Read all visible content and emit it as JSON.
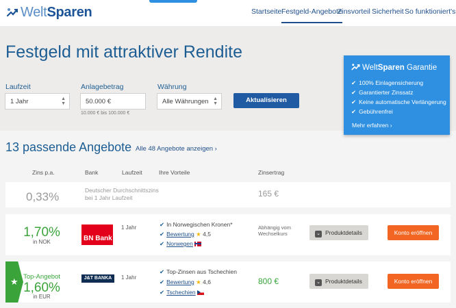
{
  "brand": {
    "part1": "Welt",
    "part2": "Sparen"
  },
  "nav": [
    "Startseite",
    "Festgeld-Angebote",
    "Zinsvorteil",
    "Sicherheit",
    "So funktioniert's"
  ],
  "hero": {
    "title": "Festgeld mit attraktiver Rendite",
    "laufzeit_label": "Laufzeit",
    "laufzeit_value": "1 Jahr",
    "betrag_label": "Anlagebetrag",
    "betrag_value": "50.000 €",
    "betrag_hint": "10.000 € bis 100.000 €",
    "waehrung_label": "Währung",
    "waehrung_value": "Alle Währungen",
    "update_button": "Aktualisieren"
  },
  "guarantee": {
    "brand1": "Welt",
    "brand2": "Sparen",
    "title": "Garantie",
    "items": [
      "100% Einlagensicherung",
      "Garantierter Zinssatz",
      "Keine automatische Verlängerung",
      "Gebührenfrei"
    ],
    "more_link": "Mehr erfahren ›"
  },
  "results": {
    "title": "13 passende Angebote",
    "all_link": "Alle 48 Angebote anzeigen ›",
    "columns": [
      "Zins p.a.",
      "Bank",
      "Laufzeit",
      "Ihre Vorteile",
      "Zinsertrag"
    ]
  },
  "average": {
    "rate": "0,33%",
    "text_line1": "Deutscher Durchschnittszins",
    "text_line2": "bei 1 Jahr Laufzeit",
    "interest": "165 €"
  },
  "offers": [
    {
      "top_label": "",
      "rate": "1,70%",
      "currency_text": "in NOK",
      "bank": "BN Bank",
      "term": "1 Jahr",
      "feature1": "In Norwegischen Kronen*",
      "rating_label": "Bewertung",
      "rating": "4,5",
      "country": "Norwegen",
      "interest_line1": "Abhängig vom",
      "interest_line2": "Wechselkurs",
      "details_button": "Produktdetails",
      "open_button": "Konto eröffnen"
    },
    {
      "top_label": "Top-Angebot",
      "rate": "1,60%",
      "currency_text": "in EUR",
      "bank": "J&T BANKA",
      "term": "1 Jahr",
      "feature1": "Top-Zinsen aus Tschechien",
      "rating_label": "Bewertung",
      "rating": "4,6",
      "country": "Tschechien",
      "interest": "800 €",
      "details_button": "Produktdetails",
      "open_button": "Konto eröffnen"
    }
  ],
  "colors": {
    "brand_blue": "#1c5d93",
    "accent_blue": "#2f8fe0",
    "green": "#3aa43a",
    "orange": "#f26522"
  }
}
